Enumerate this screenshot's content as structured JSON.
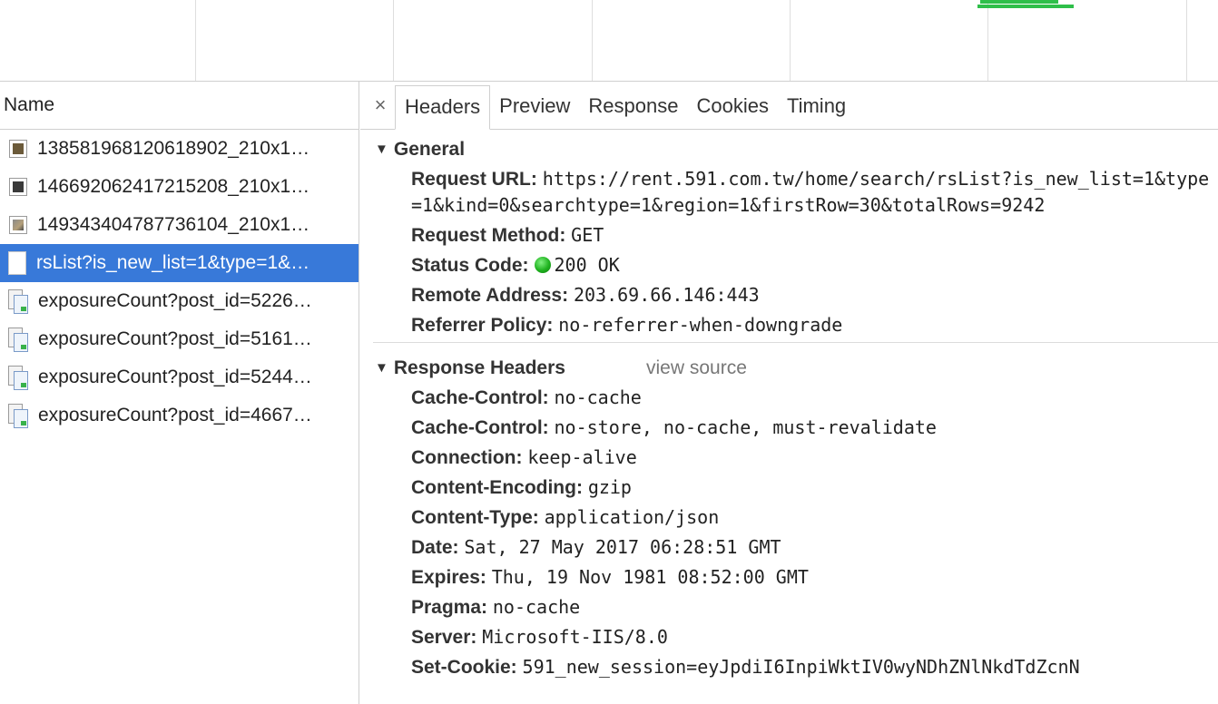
{
  "requests": {
    "header": "Name",
    "items": [
      {
        "name": "138581968120618902_210x1…",
        "icon": "image-thumbnail-icon"
      },
      {
        "name": "146692062417215208_210x1…",
        "icon": "image-thumbnail-icon"
      },
      {
        "name": "149343404787736104_210x1…",
        "icon": "image-thumbnail-icon"
      },
      {
        "name": "rsList?is_new_list=1&type=1&…",
        "icon": "document-icon",
        "selected": true
      },
      {
        "name": "exposureCount?post_id=5226…",
        "icon": "xhr-icon"
      },
      {
        "name": "exposureCount?post_id=5161…",
        "icon": "xhr-icon"
      },
      {
        "name": "exposureCount?post_id=5244…",
        "icon": "xhr-icon"
      },
      {
        "name": "exposureCount?post_id=4667…",
        "icon": "xhr-icon"
      }
    ]
  },
  "tabs": {
    "close": "×",
    "items": [
      "Headers",
      "Preview",
      "Response",
      "Cookies",
      "Timing"
    ],
    "active": "Headers"
  },
  "general": {
    "title": "General",
    "request_url_label": "Request URL:",
    "request_url": "https://rent.591.com.tw/home/search/rsList?is_new_list=1&type=1&kind=0&searchtype=1&region=1&firstRow=30&totalRows=9242",
    "method_label": "Request Method:",
    "method": "GET",
    "status_label": "Status Code:",
    "status": "200 OK",
    "status_color": "#1fb21f",
    "remote_label": "Remote Address:",
    "remote": "203.69.66.146:443",
    "referrer_label": "Referrer Policy:",
    "referrer": "no-referrer-when-downgrade"
  },
  "response_headers": {
    "title": "Response Headers",
    "view_source": "view source",
    "items": [
      {
        "k": "Cache-Control:",
        "v": "no-cache"
      },
      {
        "k": "Cache-Control:",
        "v": "no-store, no-cache, must-revalidate"
      },
      {
        "k": "Connection:",
        "v": "keep-alive"
      },
      {
        "k": "Content-Encoding:",
        "v": "gzip"
      },
      {
        "k": "Content-Type:",
        "v": "application/json"
      },
      {
        "k": "Date:",
        "v": "Sat, 27 May 2017 06:28:51 GMT"
      },
      {
        "k": "Expires:",
        "v": "Thu, 19 Nov 1981 08:52:00 GMT"
      },
      {
        "k": "Pragma:",
        "v": "no-cache"
      },
      {
        "k": "Server:",
        "v": "Microsoft-IIS/8.0"
      },
      {
        "k": "Set-Cookie:",
        "v": "591_new_session=eyJpdiI6InpiWktIV0wyNDhZNlNkdTdZcnN"
      }
    ]
  },
  "colors": {
    "selected_row": "#3879d9",
    "timeline_bar": "#2fbf4a"
  }
}
